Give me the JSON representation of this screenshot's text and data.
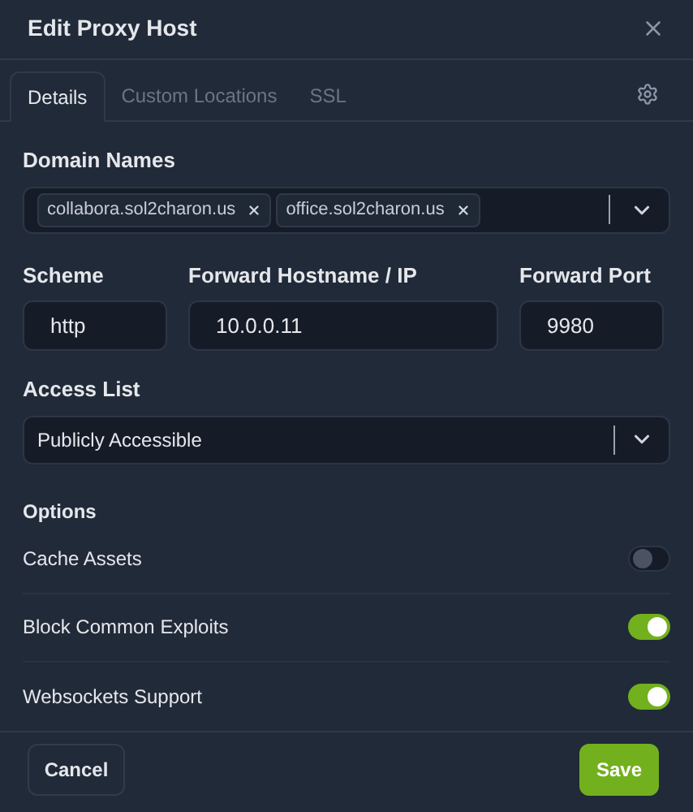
{
  "dialog": {
    "title": "Edit Proxy Host"
  },
  "tabs": [
    {
      "label": "Details",
      "selected": true
    },
    {
      "label": "Custom Locations",
      "selected": false
    },
    {
      "label": "SSL",
      "selected": false
    }
  ],
  "domain_names": {
    "label": "Domain Names",
    "tags": [
      "collabora.sol2charon.us",
      "office.sol2charon.us"
    ]
  },
  "scheme": {
    "label": "Scheme",
    "value": "http"
  },
  "forward_host": {
    "label": "Forward Hostname / IP",
    "value": "10.0.0.11"
  },
  "forward_port": {
    "label": "Forward Port",
    "value": "9980"
  },
  "access_list": {
    "label": "Access List",
    "value": "Publicly Accessible"
  },
  "options": {
    "title": "Options",
    "items": [
      {
        "label": "Cache Assets",
        "on": false
      },
      {
        "label": "Block Common Exploits",
        "on": true
      },
      {
        "label": "Websockets Support",
        "on": true
      }
    ]
  },
  "buttons": {
    "cancel": "Cancel",
    "save": "Save"
  }
}
